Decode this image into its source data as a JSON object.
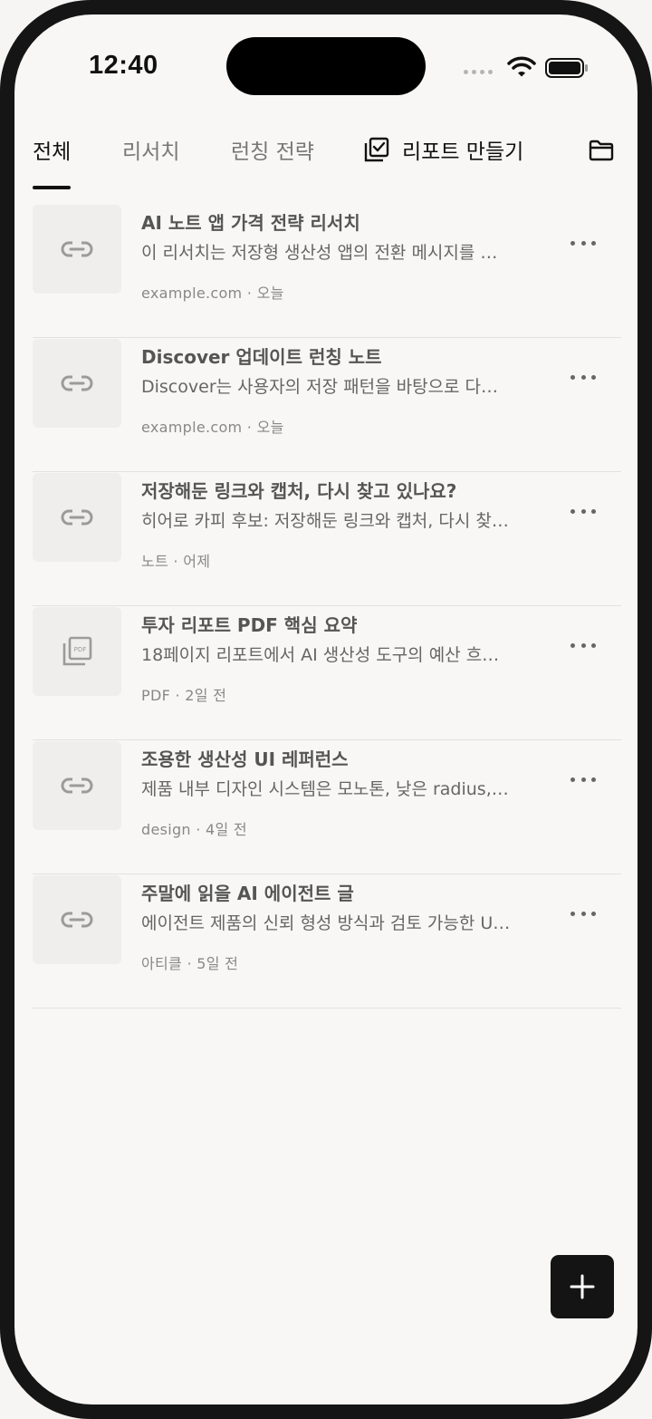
{
  "status": {
    "time": "12:40"
  },
  "tabs": [
    {
      "label": "전체",
      "active": true
    },
    {
      "label": "리서치",
      "active": false
    },
    {
      "label": "런칭 전략",
      "active": false
    }
  ],
  "report_button": {
    "label": "리포트 만들기",
    "icon": "checklist-icon"
  },
  "folder_button": {
    "icon": "folder-icon"
  },
  "items": [
    {
      "title": "AI 노트 앱 가격 전략 리서치",
      "desc": "이 리서치는 저장형 생산성 앱의 전환 메시지를 …",
      "meta": "example.com · 오늘",
      "icon": "link-icon"
    },
    {
      "title": "Discover 업데이트 런칭 노트",
      "desc": "Discover는 사용자의 저장 패턴을 바탕으로 다…",
      "meta": "example.com · 오늘",
      "icon": "link-icon"
    },
    {
      "title": "저장해둔 링크와 캡처, 다시 찾고 있나요?",
      "desc": "히어로 카피 후보: 저장해둔 링크와 캡처, 다시 찾…",
      "meta": "노트 · 어제",
      "icon": "link-icon"
    },
    {
      "title": "투자 리포트 PDF 핵심 요약",
      "desc": "18페이지 리포트에서 AI 생산성 도구의 예산 흐…",
      "meta": "PDF · 2일 전",
      "icon": "pdf-icon"
    },
    {
      "title": "조용한 생산성 UI 레퍼런스",
      "desc": "제품 내부 디자인 시스템은 모노톤, 낮은 radius,…",
      "meta": "design · 4일 전",
      "icon": "link-icon"
    },
    {
      "title": "주말에 읽을 AI 에이전트 글",
      "desc": "에이전트 제품의 신뢰 형성 방식과 검토 가능한 U…",
      "meta": "아티클 · 5일 전",
      "icon": "link-icon"
    }
  ],
  "fab": {
    "icon": "plus-icon"
  }
}
